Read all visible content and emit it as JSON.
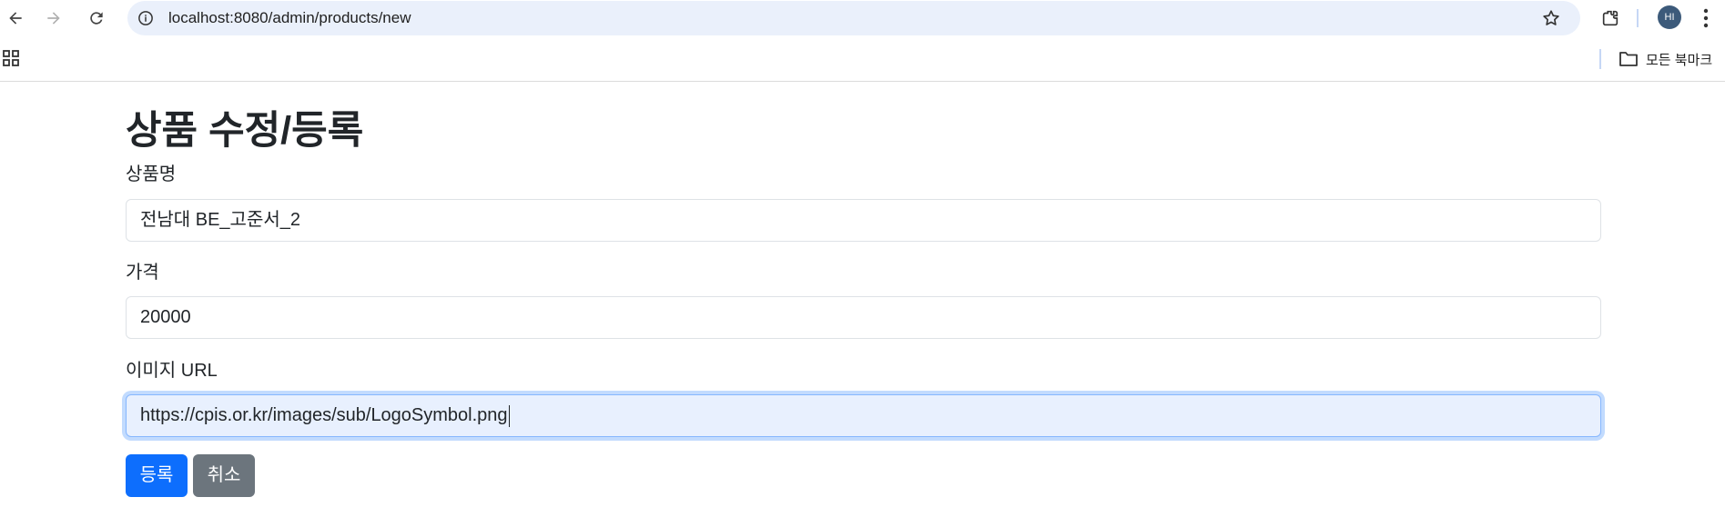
{
  "browser": {
    "url": "localhost:8080/admin/products/new",
    "avatar_initials": "HI",
    "bookmarks_all_label": "모든 북마크"
  },
  "form": {
    "title": "상품 수정/등록",
    "fields": [
      {
        "label": "상품명",
        "value": "전남대 BE_고준서_2"
      },
      {
        "label": "가격",
        "value": "20000"
      },
      {
        "label": "이미지 URL",
        "value": "https://cpis.or.kr/images/sub/LogoSymbol.png",
        "focused": true
      }
    ],
    "submit_label": "등록",
    "cancel_label": "취소"
  },
  "colors": {
    "primary": "#0d6efd",
    "secondary": "#6c757d",
    "focus_bg": "#e8f0fe",
    "omnibox_bg": "#eaf0fb"
  },
  "icons": [
    "back-arrow-icon",
    "forward-arrow-icon",
    "reload-icon",
    "site-info-icon",
    "bookmark-star-icon",
    "extensions-icon",
    "kebab-menu-icon",
    "apps-grid-icon",
    "folder-icon"
  ]
}
